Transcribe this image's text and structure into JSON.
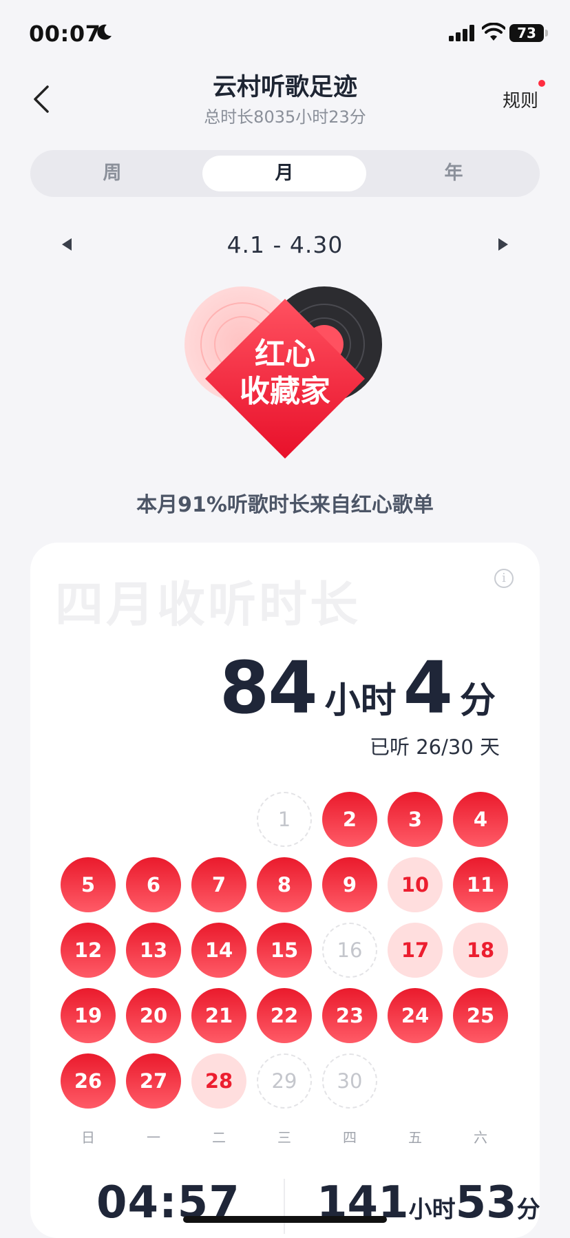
{
  "status_bar": {
    "time": "00:07",
    "battery": "73"
  },
  "header": {
    "title": "云村听歌足迹",
    "subtitle": "总时长8035小时23分",
    "rules": "规则"
  },
  "tabs": [
    {
      "label": "周",
      "active": false
    },
    {
      "label": "月",
      "active": true
    },
    {
      "label": "年",
      "active": false
    }
  ],
  "date_range": "4.1 - 4.30",
  "badge": {
    "line1": "红心",
    "line2": "收藏家"
  },
  "summary": "本月91%听歌时长来自红心歌单",
  "card": {
    "watermark": "四月收听时长",
    "hours": "84",
    "hours_unit": "小时",
    "minutes": "4",
    "minutes_unit": "分",
    "days_heard": "已听 26/30 天",
    "calendar_leading_blanks": 3,
    "calendar": [
      {
        "day": "1",
        "level": "none"
      },
      {
        "day": "2",
        "level": "full"
      },
      {
        "day": "3",
        "level": "full"
      },
      {
        "day": "4",
        "level": "full"
      },
      {
        "day": "5",
        "level": "full"
      },
      {
        "day": "6",
        "level": "full"
      },
      {
        "day": "7",
        "level": "full"
      },
      {
        "day": "8",
        "level": "full"
      },
      {
        "day": "9",
        "level": "full"
      },
      {
        "day": "10",
        "level": "light"
      },
      {
        "day": "11",
        "level": "full"
      },
      {
        "day": "12",
        "level": "full"
      },
      {
        "day": "13",
        "level": "full"
      },
      {
        "day": "14",
        "level": "full"
      },
      {
        "day": "15",
        "level": "full"
      },
      {
        "day": "16",
        "level": "none"
      },
      {
        "day": "17",
        "level": "light"
      },
      {
        "day": "18",
        "level": "light"
      },
      {
        "day": "19",
        "level": "full"
      },
      {
        "day": "20",
        "level": "full"
      },
      {
        "day": "21",
        "level": "full"
      },
      {
        "day": "22",
        "level": "full"
      },
      {
        "day": "23",
        "level": "full"
      },
      {
        "day": "24",
        "level": "full"
      },
      {
        "day": "25",
        "level": "full"
      },
      {
        "day": "26",
        "level": "full"
      },
      {
        "day": "27",
        "level": "full"
      },
      {
        "day": "28",
        "level": "light"
      },
      {
        "day": "29",
        "level": "none"
      },
      {
        "day": "30",
        "level": "none"
      }
    ],
    "weekdays": [
      "日",
      "一",
      "二",
      "三",
      "四",
      "五",
      "六"
    ],
    "stat_left": "04:57",
    "stat_right": {
      "hours": "141",
      "hours_unit": "小时",
      "minutes": "53",
      "minutes_unit": "分"
    }
  },
  "colors": {
    "accent": "#ec1e2f",
    "accent_light": "#ffdede",
    "text_dark": "#1f2638"
  },
  "icons": {
    "back": "chevron-left-icon",
    "moon": "moon-icon",
    "signal": "signal-icon",
    "wifi": "wifi-icon",
    "info": "info-icon"
  }
}
